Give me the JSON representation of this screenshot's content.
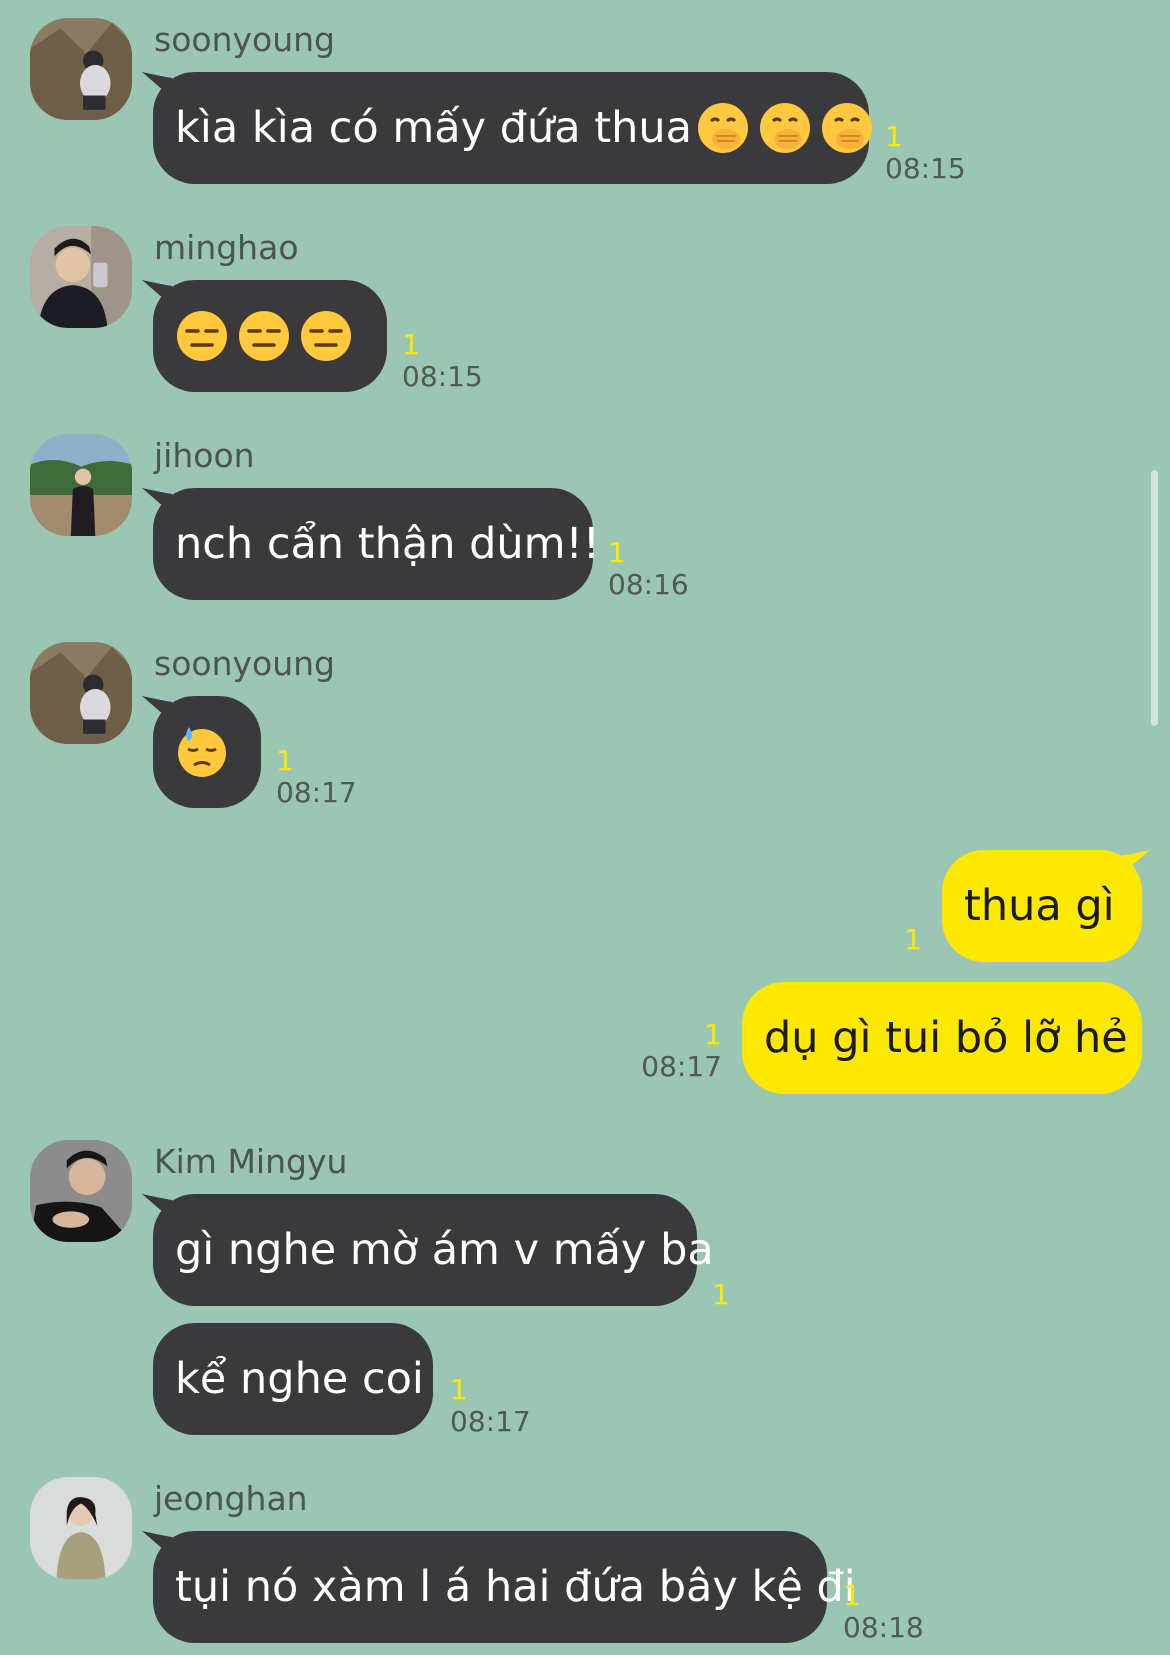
{
  "messages": [
    {
      "sender": "soonyoung",
      "text": "kìa kìa có mấy đứa thua",
      "emoji": "face-with-hand-over-mouth x3",
      "unread": "1",
      "time": "08:15"
    },
    {
      "sender": "minghao",
      "emoji": "expressionless-face x3",
      "unread": "1",
      "time": "08:15"
    },
    {
      "sender": "jihoon",
      "text": "nch cẩn thận dùm!!",
      "unread": "1",
      "time": "08:16"
    },
    {
      "sender": "soonyoung",
      "emoji": "downcast-face-with-sweat",
      "unread": "1",
      "time": "08:17"
    },
    {
      "outgoing": true,
      "text": "thua gì",
      "unread": "1"
    },
    {
      "outgoing": true,
      "text": "dụ gì tui bỏ lỡ hẻ",
      "unread": "1",
      "time": "08:17"
    },
    {
      "sender": "Kim Mingyu",
      "text": "gì nghe mờ ám v mấy ba",
      "unread": "1"
    },
    {
      "sender": "Kim Mingyu",
      "text": "kể nghe coi",
      "unread": "1",
      "time": "08:17"
    },
    {
      "sender": "jeonghan",
      "text": "tụi nó xàm l á hai đứa bây kệ đi",
      "unread": "1",
      "time": "08:18"
    }
  ],
  "colors": {
    "background": "#9cc6b4",
    "incoming_bubble": "#3a3a3c",
    "outgoing_bubble": "#fde800",
    "unread_count": "#fde800"
  }
}
